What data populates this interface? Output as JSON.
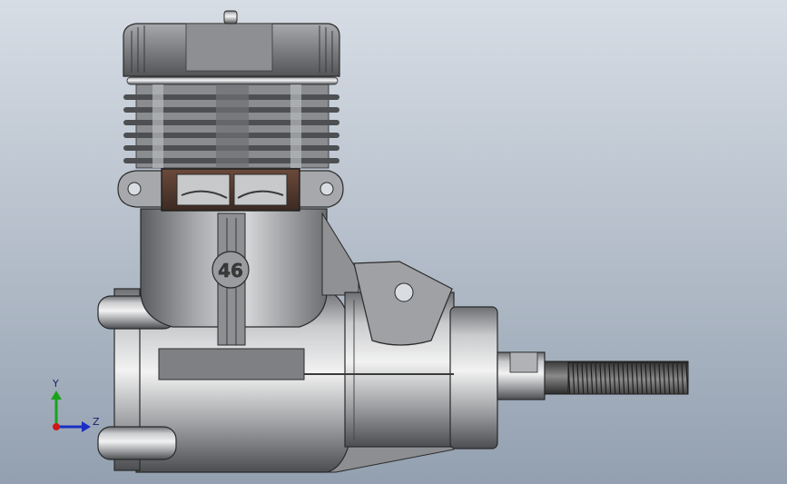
{
  "viewport": {
    "background_top": "#d7dde5",
    "background_bottom": "#93a0b0"
  },
  "model": {
    "part_marking": "46"
  },
  "triad": {
    "y_label": "Y",
    "z_label": "Z",
    "y_color": "#1aa31a",
    "z_color": "#1a2fc4",
    "x_color": "#d01818"
  }
}
